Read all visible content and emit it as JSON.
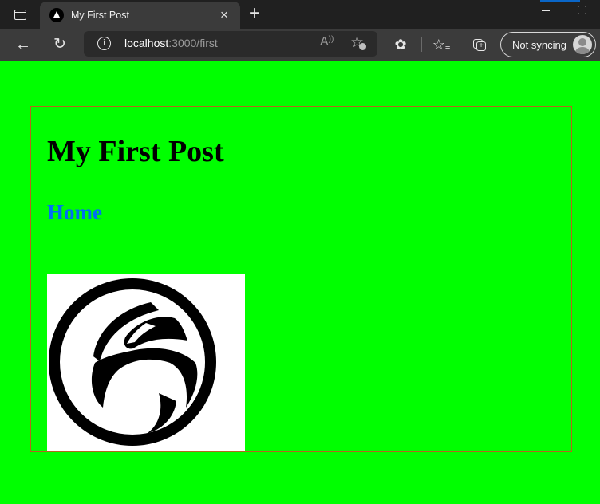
{
  "browser": {
    "tab": {
      "title": "My First Post",
      "close_glyph": "×"
    },
    "new_tab_glyph": "+",
    "address_bar": {
      "host": "localhost",
      "rest": ":3000/first"
    },
    "read_aloud_glyph": "A",
    "profile_button_label": "Not syncing",
    "icons": {
      "back": "←",
      "reload": "↻",
      "info": "i",
      "extensions": "✿",
      "favorites": "☆",
      "add_favorite": "☆"
    }
  },
  "page": {
    "title": "My First Post",
    "home_link": "Home",
    "image_alt": "Eagle head logo in circle",
    "background_color": "#00ff00",
    "link_color": "#0070f3",
    "container_border_color": "#b5651d"
  }
}
